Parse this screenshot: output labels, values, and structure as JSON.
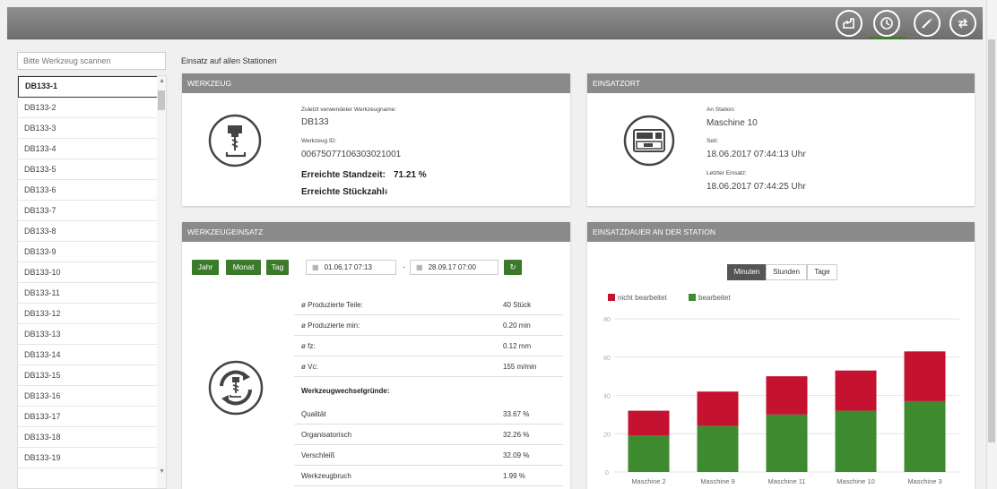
{
  "nav": {
    "icons": [
      "factory-icon",
      "clock-icon",
      "tool-icon",
      "exchange-icon"
    ],
    "active_index": 1
  },
  "sidebar": {
    "scanner_placeholder": "Bitte Werkzeug scannen",
    "items": [
      "DB133-1",
      "DB133-2",
      "DB133-3",
      "DB133-4",
      "DB133-5",
      "DB133-6",
      "DB133-7",
      "DB133-8",
      "DB133-9",
      "DB133-10",
      "DB133-11",
      "DB133-12",
      "DB133-13",
      "DB133-14",
      "DB133-15",
      "DB133-16",
      "DB133-17",
      "DB133-18",
      "DB133-19"
    ],
    "selected_index": 0
  },
  "page_title": "Einsatz auf allen Stationen",
  "werkzeug": {
    "header": "WERKZEUG",
    "name_label": "Zuletzt verwendeter Werkzeugname:",
    "name_value": "DB133",
    "id_label": "Werkzeug ID:",
    "id_value": "00675077106303021001",
    "standzeit_label": "Erreichte Standzeit:",
    "standzeit_value": "71.21 %",
    "stueckzahl_label": "Erreichte Stückzahl:",
    "stueckzahl_value": "-"
  },
  "einsatzort": {
    "header": "EINSATZORT",
    "station_label": "An Station:",
    "station_value": "Maschine 10",
    "seit_label": "Seit:",
    "seit_value": "18.06.2017 07:44:13 Uhr",
    "letzter_label": "Letzter Einsatz:",
    "letzter_value": "18.06.2017 07:44:25 Uhr"
  },
  "werkzeugeinsatz": {
    "header": "WERKZEUGEINSATZ",
    "btn_jahr": "Jahr",
    "btn_monat": "Monat",
    "btn_tag": "Tag",
    "date_from": "01.06.17 07:13",
    "date_sep": "-",
    "date_to": "28.09.17 07:00",
    "stats": [
      {
        "label": "ø Produzierte Teile:",
        "value": "40 Stück"
      },
      {
        "label": "ø Produzierte min:",
        "value": "0.20 min"
      },
      {
        "label": "ø fz:",
        "value": "0.12 mm"
      },
      {
        "label": "ø Vc:",
        "value": "155 m/min"
      }
    ],
    "reasons_title": "Werkzeugwechselgründe:",
    "reasons": [
      {
        "label": "Qualität",
        "value": "33.67 %"
      },
      {
        "label": "Organisatorisch",
        "value": "32.26 %"
      },
      {
        "label": "Verschleiß",
        "value": "32.09 %"
      },
      {
        "label": "Werkzeugbruch",
        "value": "1.99 %"
      }
    ]
  },
  "einsatzdauer": {
    "header": "EINSATZDAUER AN DER STATION",
    "seg_minuten": "Minuten",
    "seg_stunden": "Stunden",
    "seg_tage": "Tage"
  },
  "chart_data": {
    "type": "bar",
    "stacked": true,
    "categories": [
      "Maschine 2",
      "Maschine 9",
      "Maschine 11",
      "Maschine 10",
      "Maschine 3"
    ],
    "series": [
      {
        "name": "bearbeitet",
        "color": "#3d8a2f",
        "values": [
          19,
          24,
          30,
          32,
          37
        ]
      },
      {
        "name": "nicht bearbeitet",
        "color": "#c41230",
        "values": [
          13,
          18,
          20,
          21,
          26
        ]
      }
    ],
    "legend_order": [
      "nicht bearbeitet",
      "bearbeitet"
    ],
    "ylim": [
      0,
      80
    ],
    "yticks": [
      "0",
      "20",
      "40",
      "60",
      "80"
    ],
    "grid": true,
    "legend_position": "top-left"
  }
}
